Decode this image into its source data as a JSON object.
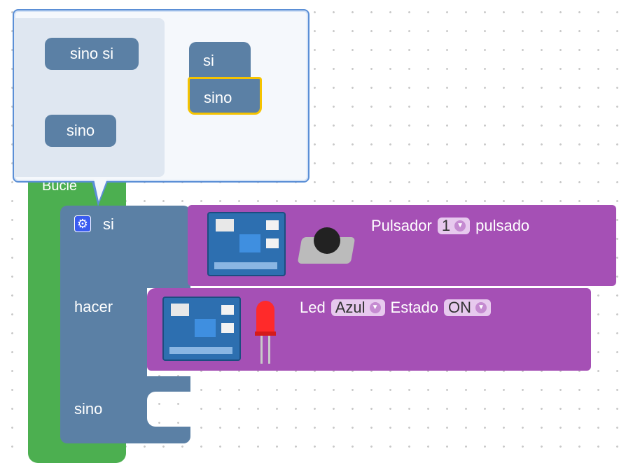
{
  "mutator": {
    "flyout_blocks": [
      "sino si",
      "sino"
    ],
    "container_blocks": [
      "si",
      "sino"
    ]
  },
  "event_block": {
    "label": "Bucle"
  },
  "if_block": {
    "if_label": "si",
    "do_label": "hacer",
    "else_label": "sino"
  },
  "button_block": {
    "prefix": "Pulsador",
    "value": "1",
    "suffix": "pulsado"
  },
  "led_block": {
    "prefix": "Led",
    "color_value": "Azul",
    "state_label": "Estado",
    "state_value": "ON"
  },
  "colors": {
    "if_blue": "#5b80a5",
    "event_green": "#4caf50",
    "sensor_purple": "#a550b5",
    "highlight_yellow": "#f5c300"
  },
  "icons": [
    "gear-icon",
    "arduino-board-icon",
    "push-button-icon",
    "red-led-icon"
  ]
}
